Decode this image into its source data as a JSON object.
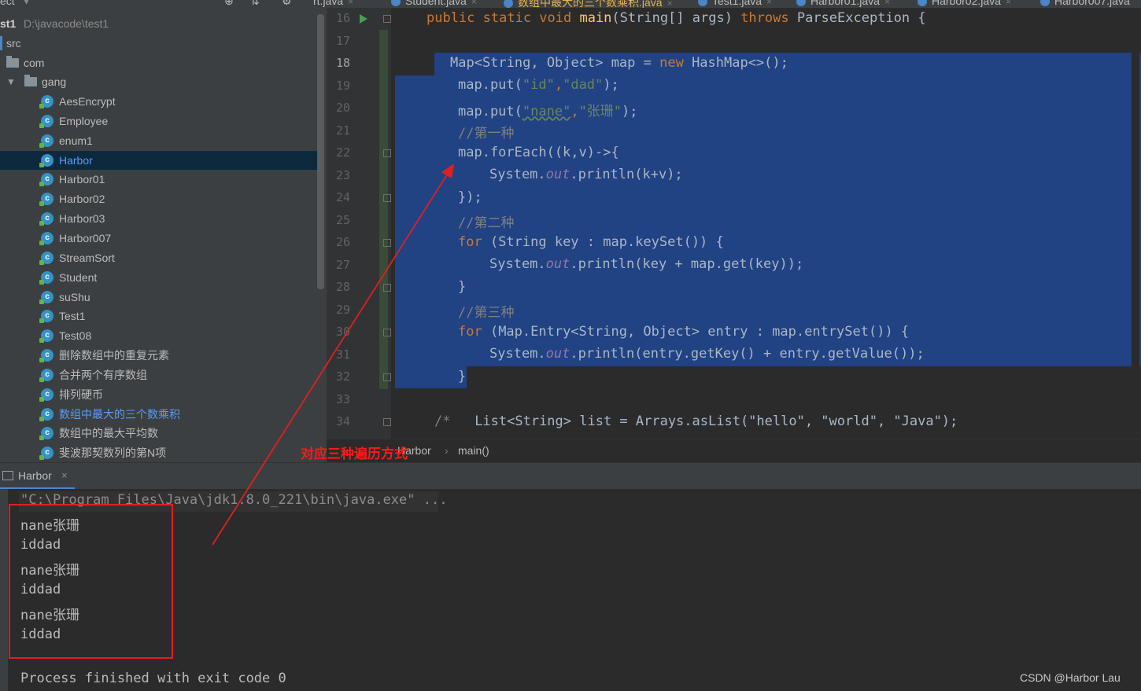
{
  "tabs": {
    "top_left": "ect",
    "items": [
      "rt.java",
      "Student.java",
      "数组中最大的三个数乘积.java",
      "Test1.java",
      "Harbor01.java",
      "Harbor02.java",
      "Harbor007.java"
    ]
  },
  "project": {
    "root_name": "st1",
    "root_path": "D:\\javacode\\test1",
    "src": "src",
    "com": "com",
    "gang": "gang",
    "classes": [
      "AesEncrypt",
      "Employee",
      "enum1",
      "Harbor",
      "Harbor01",
      "Harbor02",
      "Harbor03",
      "Harbor007",
      "StreamSort",
      "Student",
      "suShu",
      "Test1",
      "Test08",
      "删除数组中的重复元素",
      "合并两个有序数组",
      "排列硬币",
      "数组中最大的三个数乘积",
      "数组中的最大平均数",
      "斐波那契数列的第N项"
    ],
    "selected": "Harbor"
  },
  "editor": {
    "line_numbers": [
      "16",
      "17",
      "18",
      "19",
      "20",
      "21",
      "22",
      "23",
      "24",
      "25",
      "26",
      "27",
      "28",
      "29",
      "30",
      "31",
      "32",
      "33",
      "34"
    ],
    "current_line": "18",
    "code": {
      "l16_a": "public static void ",
      "l16_fn": "main",
      "l16_b": "(String[] args) ",
      "l16_kw": "throws",
      "l16_c": " ParseException {",
      "l18_a": "Map<String, Object> map = ",
      "l18_kw": "new",
      "l18_b": " HashMap<>();",
      "l19_a": "map.put(",
      "l19_s1": "\"id\"",
      "l19_b": ",",
      "l19_s2": "\"dad\"",
      "l19_c": ");",
      "l20_a": "map.put(",
      "l20_s1": "\"nane\"",
      "l20_b": ",",
      "l20_s2": "\"张珊\"",
      "l20_c": ");",
      "l21": "//第一种",
      "l22": "map.forEach((k,v)->{",
      "l23_a": "System.",
      "l23_f": "out",
      "l23_b": ".println(k+v);",
      "l24": "});",
      "l25": "//第二种",
      "l26_kw": "for",
      "l26_a": " (String key : map.keySet()) {",
      "l27_a": "System.",
      "l27_f": "out",
      "l27_b": ".println(key + map.get(key));",
      "l28": "}",
      "l29": "//第三种",
      "l30_kw": "for",
      "l30_a": " (Map.Entry<String, Object> entry : map.entrySet()) {",
      "l31_a": "System.",
      "l31_f": "out",
      "l31_b": ".println(entry.getKey() + entry.getValue());",
      "l32": "}",
      "l34_cmt": "/*",
      "l34_a": "   List<String> list = Arrays.asList(\"hello\", \"world\", \"Java\");"
    },
    "breadcrumb": [
      "Harbor",
      "main()"
    ]
  },
  "run": {
    "tab_label": "Harbor",
    "command": "\"C:\\Program Files\\Java\\jdk1.8.0_221\\bin\\java.exe\" ...",
    "output": [
      "nane张珊",
      "iddad",
      "nane张珊",
      "iddad",
      "nane张珊",
      "iddad"
    ],
    "exit": "Process finished with exit code 0"
  },
  "annotation": "对应三种遍历方式",
  "watermark": "CSDN @Harbor Lau",
  "colors": {
    "annotation_red": "#e02020",
    "selection": "#214283",
    "keyword": "#cc7832",
    "string": "#6a8759"
  }
}
